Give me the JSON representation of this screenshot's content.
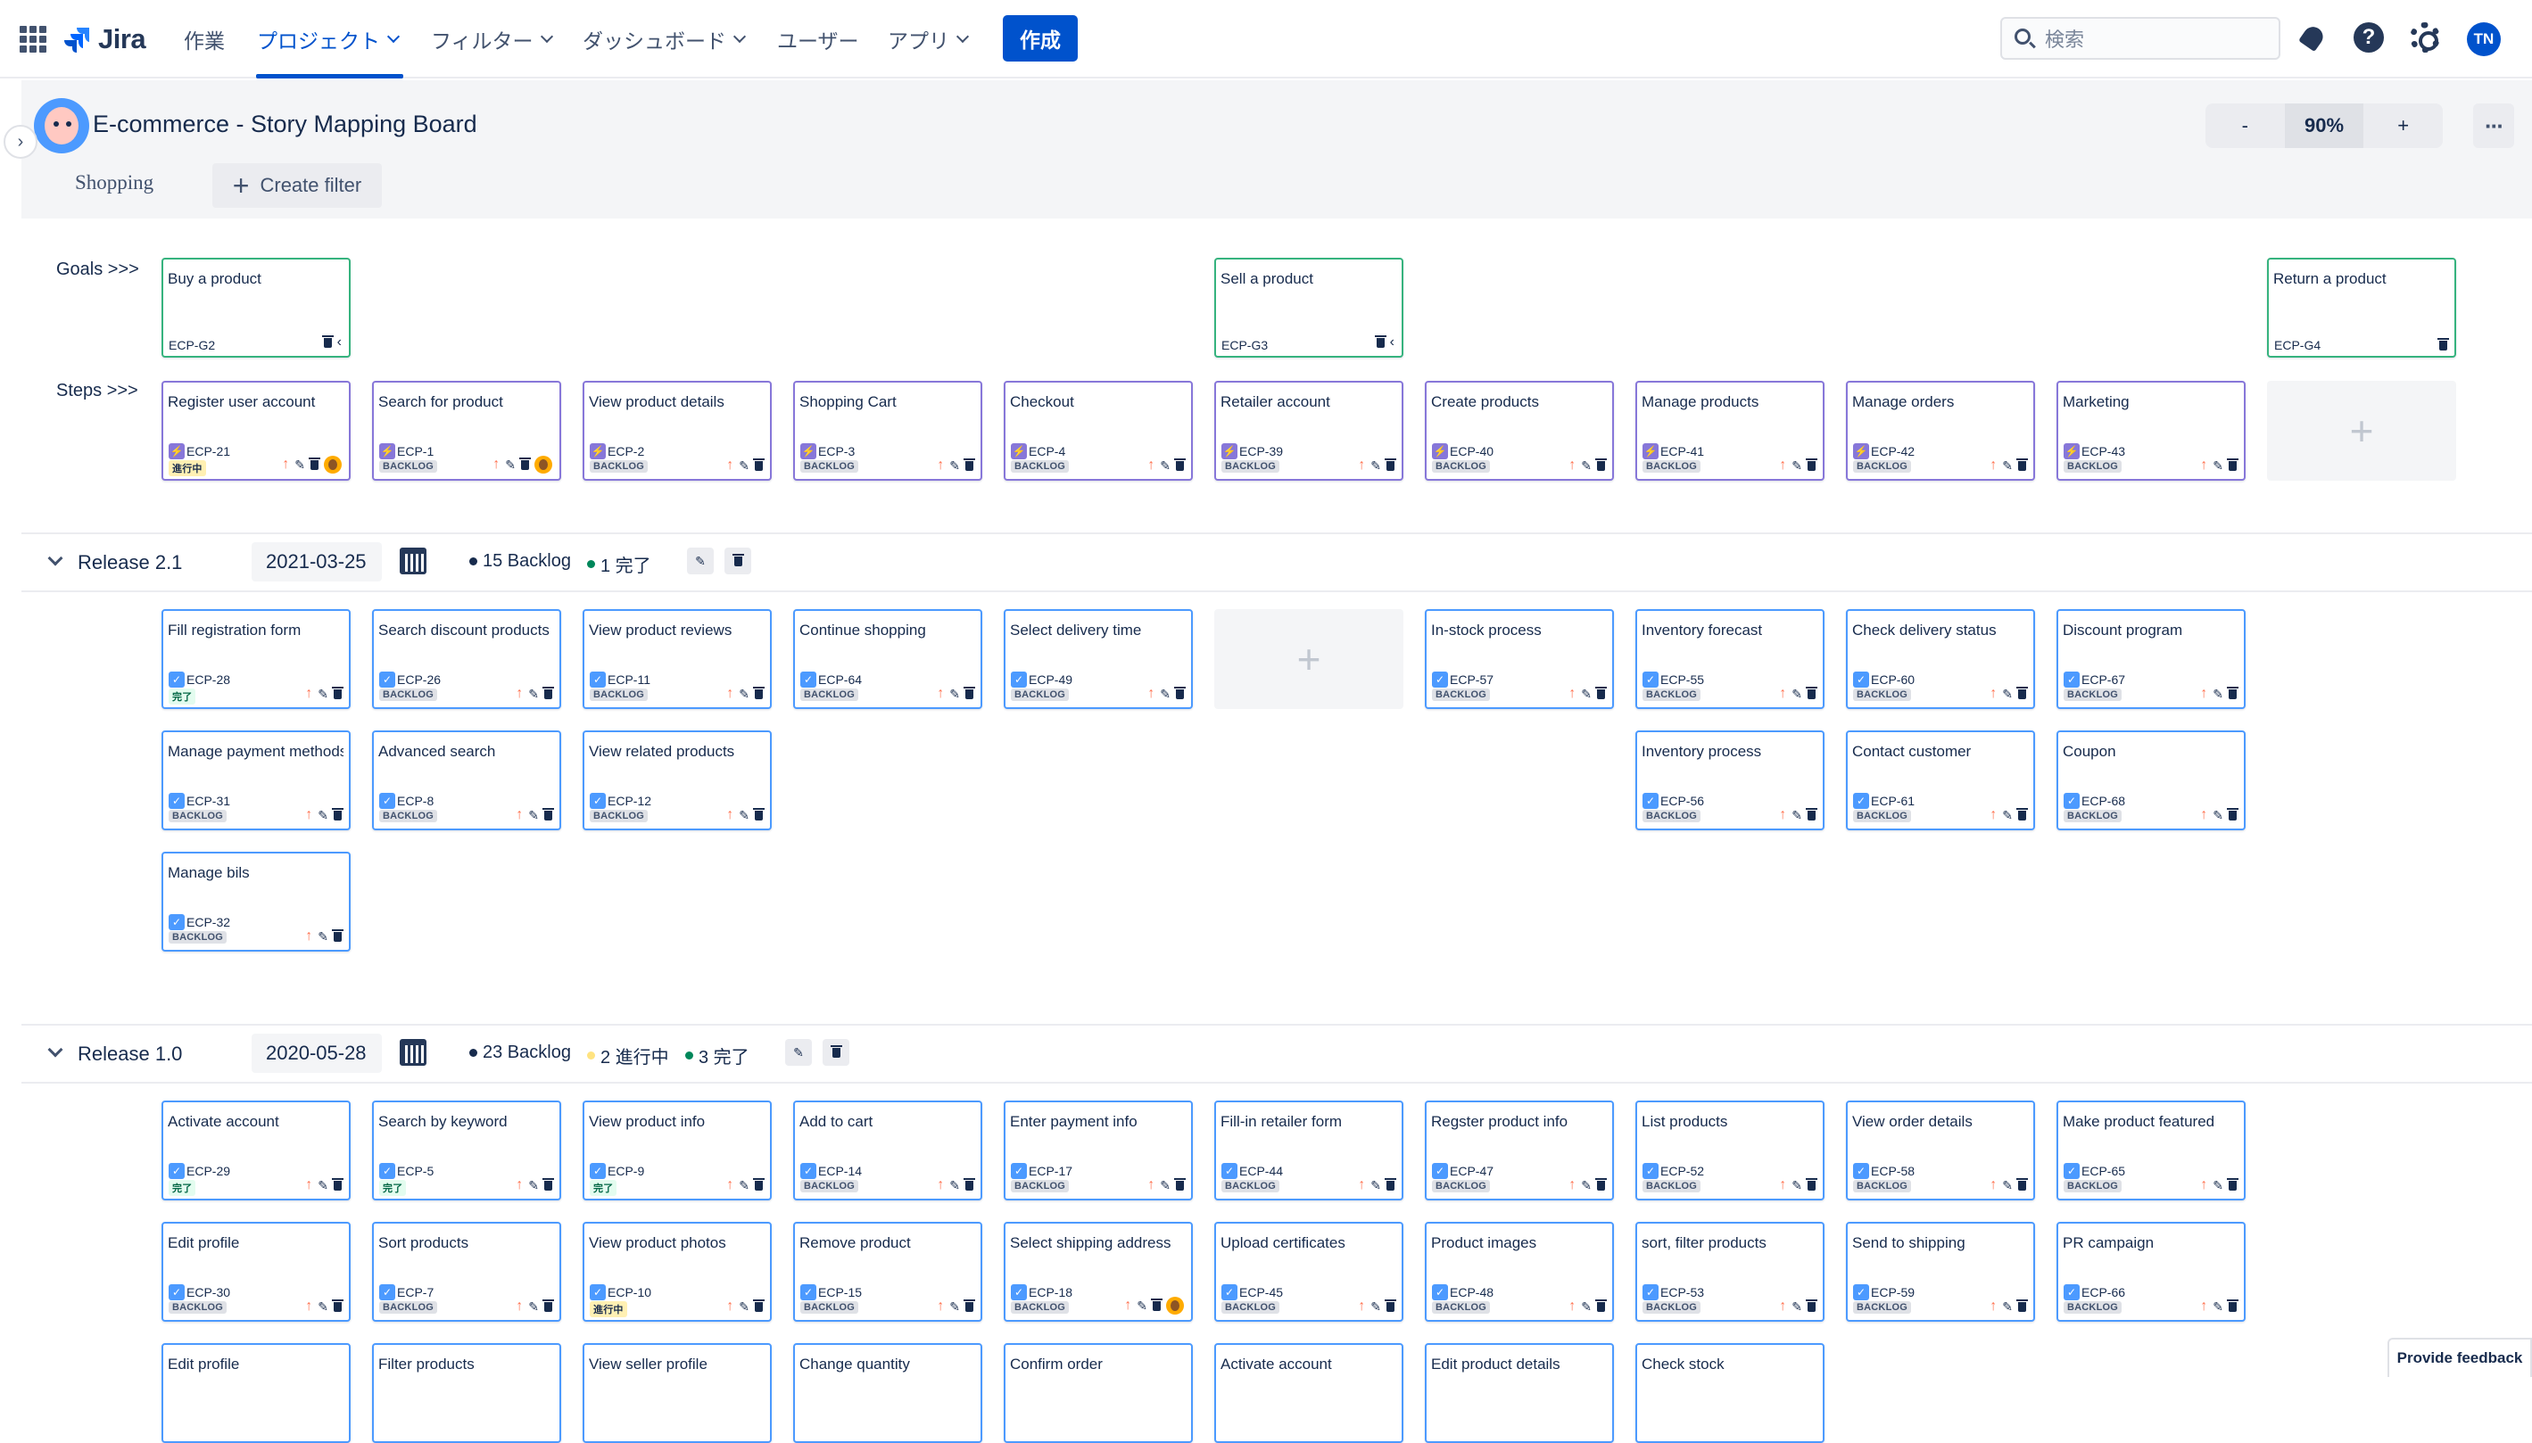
{
  "nav": {
    "logo": "Jira",
    "items": [
      {
        "label": "作業",
        "caret": false,
        "active": false
      },
      {
        "label": "プロジェクト",
        "caret": true,
        "active": true
      },
      {
        "label": "フィルター",
        "caret": true,
        "active": false
      },
      {
        "label": "ダッシュボード",
        "caret": true,
        "active": false
      },
      {
        "label": "ユーザー",
        "caret": false,
        "active": false
      },
      {
        "label": "アプリ",
        "caret": true,
        "active": false
      }
    ],
    "create_label": "作成",
    "search_placeholder": "検索",
    "avatar_initials": "TN"
  },
  "board": {
    "title": "E-commerce - Story Mapping Board",
    "tab": "Shopping",
    "create_filter": "Create filter",
    "zoom_minus": "-",
    "zoom_value": "90%",
    "zoom_plus": "+",
    "more": "···"
  },
  "row_labels": {
    "goals": "Goals >>>",
    "steps": "Steps >>>"
  },
  "goals": [
    {
      "title": "Buy a product",
      "key": "ECP-G2",
      "col": 0,
      "chevron": true
    },
    {
      "title": "Sell a product",
      "key": "ECP-G3",
      "col": 5,
      "chevron": true
    },
    {
      "title": "Return a product",
      "key": "ECP-G4",
      "col": 10,
      "chevron": false
    }
  ],
  "steps": [
    {
      "title": "Register user account",
      "key": "ECP-21",
      "status": "進行中",
      "avatar": true
    },
    {
      "title": "Search for product",
      "key": "ECP-1",
      "status": "BACKLOG",
      "avatar": true
    },
    {
      "title": "View product details",
      "key": "ECP-2",
      "status": "BACKLOG"
    },
    {
      "title": "Shopping Cart",
      "key": "ECP-3",
      "status": "BACKLOG"
    },
    {
      "title": "Checkout",
      "key": "ECP-4",
      "status": "BACKLOG"
    },
    {
      "title": "Retailer account",
      "key": "ECP-39",
      "status": "BACKLOG"
    },
    {
      "title": "Create products",
      "key": "ECP-40",
      "status": "BACKLOG"
    },
    {
      "title": "Manage products",
      "key": "ECP-41",
      "status": "BACKLOG"
    },
    {
      "title": "Manage orders",
      "key": "ECP-42",
      "status": "BACKLOG"
    },
    {
      "title": "Marketing",
      "key": "ECP-43",
      "status": "BACKLOG"
    }
  ],
  "add_label": "+",
  "releases": [
    {
      "name": "Release 2.1",
      "date": "2021-03-25",
      "stats": [
        {
          "label": "15 Backlog",
          "color": "#172b4d"
        },
        {
          "label": "1 完了",
          "color": "#00875a"
        }
      ],
      "add_cols": [
        5
      ],
      "cards": [
        {
          "col": 0,
          "row": 0,
          "title": "Fill registration form",
          "key": "ECP-28",
          "status": "完了"
        },
        {
          "col": 1,
          "row": 0,
          "title": "Search discount products",
          "key": "ECP-26",
          "status": "BACKLOG"
        },
        {
          "col": 2,
          "row": 0,
          "title": "View product reviews",
          "key": "ECP-11",
          "status": "BACKLOG"
        },
        {
          "col": 3,
          "row": 0,
          "title": "Continue shopping",
          "key": "ECP-64",
          "status": "BACKLOG"
        },
        {
          "col": 4,
          "row": 0,
          "title": "Select delivery time",
          "key": "ECP-49",
          "status": "BACKLOG"
        },
        {
          "col": 6,
          "row": 0,
          "title": "In-stock process",
          "key": "ECP-57",
          "status": "BACKLOG"
        },
        {
          "col": 7,
          "row": 0,
          "title": "Inventory forecast",
          "key": "ECP-55",
          "status": "BACKLOG"
        },
        {
          "col": 8,
          "row": 0,
          "title": "Check delivery status",
          "key": "ECP-60",
          "status": "BACKLOG"
        },
        {
          "col": 9,
          "row": 0,
          "title": "Discount program",
          "key": "ECP-67",
          "status": "BACKLOG"
        },
        {
          "col": 0,
          "row": 1,
          "title": "Manage payment methods",
          "key": "ECP-31",
          "status": "BACKLOG"
        },
        {
          "col": 1,
          "row": 1,
          "title": "Advanced search",
          "key": "ECP-8",
          "status": "BACKLOG"
        },
        {
          "col": 2,
          "row": 1,
          "title": "View related products",
          "key": "ECP-12",
          "status": "BACKLOG"
        },
        {
          "col": 7,
          "row": 1,
          "title": "Inventory process",
          "key": "ECP-56",
          "status": "BACKLOG"
        },
        {
          "col": 8,
          "row": 1,
          "title": "Contact customer",
          "key": "ECP-61",
          "status": "BACKLOG"
        },
        {
          "col": 9,
          "row": 1,
          "title": "Coupon",
          "key": "ECP-68",
          "status": "BACKLOG"
        },
        {
          "col": 0,
          "row": 2,
          "title": "Manage bils",
          "key": "ECP-32",
          "status": "BACKLOG"
        }
      ]
    },
    {
      "name": "Release 1.0",
      "date": "2020-05-28",
      "stats": [
        {
          "label": "23 Backlog",
          "color": "#172b4d"
        },
        {
          "label": "2 進行中",
          "color": "#ffe380"
        },
        {
          "label": "3 完了",
          "color": "#00875a"
        }
      ],
      "add_cols": [],
      "cards": [
        {
          "col": 0,
          "row": 0,
          "title": "Activate account",
          "key": "ECP-29",
          "status": "完了"
        },
        {
          "col": 1,
          "row": 0,
          "title": "Search by keyword",
          "key": "ECP-5",
          "status": "完了"
        },
        {
          "col": 2,
          "row": 0,
          "title": "View product info",
          "key": "ECP-9",
          "status": "完了"
        },
        {
          "col": 3,
          "row": 0,
          "title": "Add to cart",
          "key": "ECP-14",
          "status": "BACKLOG"
        },
        {
          "col": 4,
          "row": 0,
          "title": "Enter payment info",
          "key": "ECP-17",
          "status": "BACKLOG"
        },
        {
          "col": 5,
          "row": 0,
          "title": "Fill-in retailer form",
          "key": "ECP-44",
          "status": "BACKLOG"
        },
        {
          "col": 6,
          "row": 0,
          "title": "Regster product info",
          "key": "ECP-47",
          "status": "BACKLOG"
        },
        {
          "col": 7,
          "row": 0,
          "title": "List products",
          "key": "ECP-52",
          "status": "BACKLOG"
        },
        {
          "col": 8,
          "row": 0,
          "title": "View order details",
          "key": "ECP-58",
          "status": "BACKLOG"
        },
        {
          "col": 9,
          "row": 0,
          "title": "Make product featured",
          "key": "ECP-65",
          "status": "BACKLOG"
        },
        {
          "col": 0,
          "row": 1,
          "title": "Edit profile",
          "key": "ECP-30",
          "status": "BACKLOG"
        },
        {
          "col": 1,
          "row": 1,
          "title": "Sort products",
          "key": "ECP-7",
          "status": "BACKLOG"
        },
        {
          "col": 2,
          "row": 1,
          "title": "View product photos",
          "key": "ECP-10",
          "status": "進行中"
        },
        {
          "col": 3,
          "row": 1,
          "title": "Remove product",
          "key": "ECP-15",
          "status": "BACKLOG"
        },
        {
          "col": 4,
          "row": 1,
          "title": "Select shipping address",
          "key": "ECP-18",
          "status": "BACKLOG",
          "avatar": true
        },
        {
          "col": 5,
          "row": 1,
          "title": "Upload certificates",
          "key": "ECP-45",
          "status": "BACKLOG"
        },
        {
          "col": 6,
          "row": 1,
          "title": "Product images",
          "key": "ECP-48",
          "status": "BACKLOG"
        },
        {
          "col": 7,
          "row": 1,
          "title": "sort, filter products",
          "key": "ECP-53",
          "status": "BACKLOG"
        },
        {
          "col": 8,
          "row": 1,
          "title": "Send to shipping",
          "key": "ECP-59",
          "status": "BACKLOG"
        },
        {
          "col": 9,
          "row": 1,
          "title": "PR campaign",
          "key": "ECP-66",
          "status": "BACKLOG"
        },
        {
          "col": 0,
          "row": 2,
          "title": "Edit profile",
          "key": "",
          "status": ""
        },
        {
          "col": 1,
          "row": 2,
          "title": "Filter products",
          "key": "",
          "status": ""
        },
        {
          "col": 2,
          "row": 2,
          "title": "View seller profile",
          "key": "",
          "status": ""
        },
        {
          "col": 3,
          "row": 2,
          "title": "Change quantity",
          "key": "",
          "status": ""
        },
        {
          "col": 4,
          "row": 2,
          "title": "Confirm order",
          "key": "",
          "status": ""
        },
        {
          "col": 5,
          "row": 2,
          "title": "Activate account",
          "key": "",
          "status": ""
        },
        {
          "col": 6,
          "row": 2,
          "title": "Edit product details",
          "key": "",
          "status": ""
        },
        {
          "col": 7,
          "row": 2,
          "title": "Check stock",
          "key": "",
          "status": ""
        }
      ]
    }
  ],
  "feedback": "Provide feedback",
  "colors": {
    "accent": "#0052cc",
    "goal_border": "#36b37e",
    "step_border": "#8777d9",
    "story_border": "#4c9aff",
    "priority": "#ff7452"
  }
}
